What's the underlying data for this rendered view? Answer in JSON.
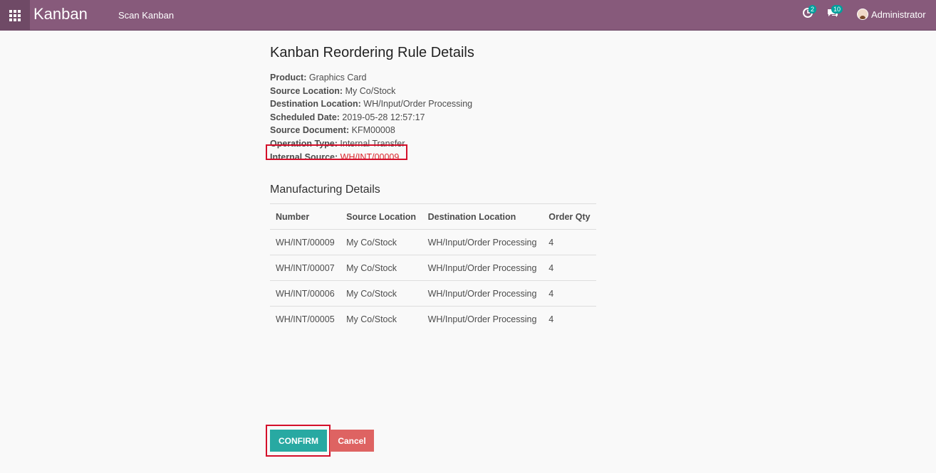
{
  "navbar": {
    "brand": "Kanban",
    "menu_item": "Scan Kanban",
    "activity_count": "2",
    "message_count": "10",
    "user_name": "Administrator"
  },
  "page": {
    "title": "Kanban Reordering Rule Details",
    "details": [
      {
        "label": "Product:",
        "value": "Graphics Card"
      },
      {
        "label": "Source Location:",
        "value": "My Co/Stock"
      },
      {
        "label": "Destination Location:",
        "value": "WH/Input/Order Processing"
      },
      {
        "label": "Scheduled Date:",
        "value": "2019-05-28 12:57:17"
      },
      {
        "label": "Source Document:",
        "value": "KFM00008"
      },
      {
        "label": "Operation Type:",
        "value": "Internal Transfer"
      },
      {
        "label": "Internal Source:",
        "value": "WH/INT/00009"
      }
    ],
    "section_title": "Manufacturing Details",
    "table": {
      "headers": [
        "Number",
        "Source Location",
        "Destination Location",
        "Order Qty"
      ],
      "rows": [
        [
          "WH/INT/00009",
          "My Co/Stock",
          "WH/Input/Order Processing",
          "4"
        ],
        [
          "WH/INT/00007",
          "My Co/Stock",
          "WH/Input/Order Processing",
          "4"
        ],
        [
          "WH/INT/00006",
          "My Co/Stock",
          "WH/Input/Order Processing",
          "4"
        ],
        [
          "WH/INT/00005",
          "My Co/Stock",
          "WH/Input/Order Processing",
          "4"
        ]
      ]
    }
  },
  "buttons": {
    "confirm": "CONFIRM",
    "cancel": "Cancel"
  },
  "colors": {
    "navbar": "#875a7b",
    "highlight": "#d40f2a",
    "confirm": "#28a9a2",
    "cancel": "#de6362"
  }
}
